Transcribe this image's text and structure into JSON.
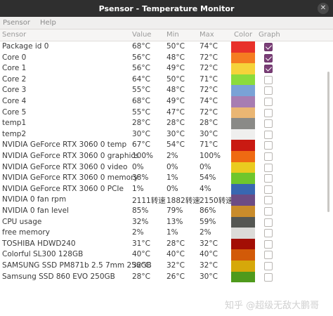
{
  "window": {
    "title": "Psensor - Temperature Monitor",
    "close_glyph": "✕"
  },
  "menu": {
    "items": [
      "Psensor",
      "Help"
    ]
  },
  "columns": {
    "sensor": "Sensor",
    "value": "Value",
    "min": "Min",
    "max": "Max",
    "color": "Color",
    "graph": "Graph"
  },
  "rows": [
    {
      "sensor": "Package id 0",
      "value": "68°C",
      "min": "50°C",
      "max": "74°C",
      "color": "#e8312a",
      "graph": true
    },
    {
      "sensor": "Core 0",
      "value": "56°C",
      "min": "48°C",
      "max": "72°C",
      "color": "#f57c21",
      "graph": true
    },
    {
      "sensor": "Core 1",
      "value": "56°C",
      "min": "49°C",
      "max": "72°C",
      "color": "#f5d33a",
      "graph": true
    },
    {
      "sensor": "Core 2",
      "value": "64°C",
      "min": "50°C",
      "max": "71°C",
      "color": "#8bdb3c",
      "graph": false
    },
    {
      "sensor": "Core 3",
      "value": "55°C",
      "min": "48°C",
      "max": "72°C",
      "color": "#7aa2d6",
      "graph": false
    },
    {
      "sensor": "Core 4",
      "value": "68°C",
      "min": "49°C",
      "max": "74°C",
      "color": "#a77db2",
      "graph": false
    },
    {
      "sensor": "Core 5",
      "value": "55°C",
      "min": "47°C",
      "max": "72°C",
      "color": "#eab673",
      "graph": false
    },
    {
      "sensor": "temp1",
      "value": "28°C",
      "min": "28°C",
      "max": "28°C",
      "color": "#8a8a87",
      "graph": false
    },
    {
      "sensor": "temp2",
      "value": "30°C",
      "min": "30°C",
      "max": "30°C",
      "color": "#efefee",
      "graph": false
    },
    {
      "sensor": "NVIDIA GeForce RTX 3060 0 temp",
      "value": "67°C",
      "min": "54°C",
      "max": "71°C",
      "color": "#c91a12",
      "graph": false
    },
    {
      "sensor": "NVIDIA GeForce RTX 3060 0 graphics",
      "value": "100%",
      "min": "2%",
      "max": "100%",
      "color": "#ef6a12",
      "graph": false
    },
    {
      "sensor": "NVIDIA GeForce RTX 3060 0 video",
      "value": "0%",
      "min": "0%",
      "max": "0%",
      "color": "#eacb1f",
      "graph": false
    },
    {
      "sensor": "NVIDIA GeForce RTX 3060 0 memory",
      "value": "38%",
      "min": "1%",
      "max": "54%",
      "color": "#6fc62c",
      "graph": false
    },
    {
      "sensor": "NVIDIA GeForce RTX 3060 0 PCIe",
      "value": "1%",
      "min": "0%",
      "max": "4%",
      "color": "#3967b1",
      "graph": false
    },
    {
      "sensor": "NVIDIA 0 fan rpm",
      "value": "2111转速",
      "min": "1882转速",
      "max": "2150转速",
      "color": "#6c4c84",
      "graph": false
    },
    {
      "sensor": "NVIDIA 0 fan level",
      "value": "85%",
      "min": "79%",
      "max": "86%",
      "color": "#c98c2b",
      "graph": false
    },
    {
      "sensor": "CPU usage",
      "value": "32%",
      "min": "13%",
      "max": "59%",
      "color": "#555753",
      "graph": false
    },
    {
      "sensor": "free memory",
      "value": "2%",
      "min": "1%",
      "max": "2%",
      "color": "#dbdbd8",
      "graph": false
    },
    {
      "sensor": "TOSHIBA HDWD240",
      "value": "31°C",
      "min": "28°C",
      "max": "32°C",
      "color": "#a30e05",
      "graph": false
    },
    {
      "sensor": "Colorful SL300 128GB",
      "value": "40°C",
      "min": "40°C",
      "max": "40°C",
      "color": "#d25a08",
      "graph": false
    },
    {
      "sensor": "SAMSUNG SSD PM871b 2.5 7mm 256GB",
      "value": "32°C",
      "min": "32°C",
      "max": "32°C",
      "color": "#d6a80a",
      "graph": false
    },
    {
      "sensor": "Samsung SSD 860 EVO 250GB",
      "value": "28°C",
      "min": "26°C",
      "max": "30°C",
      "color": "#4f9a1c",
      "graph": false
    }
  ],
  "watermark": "知乎 @超级无敌大鹏哥"
}
